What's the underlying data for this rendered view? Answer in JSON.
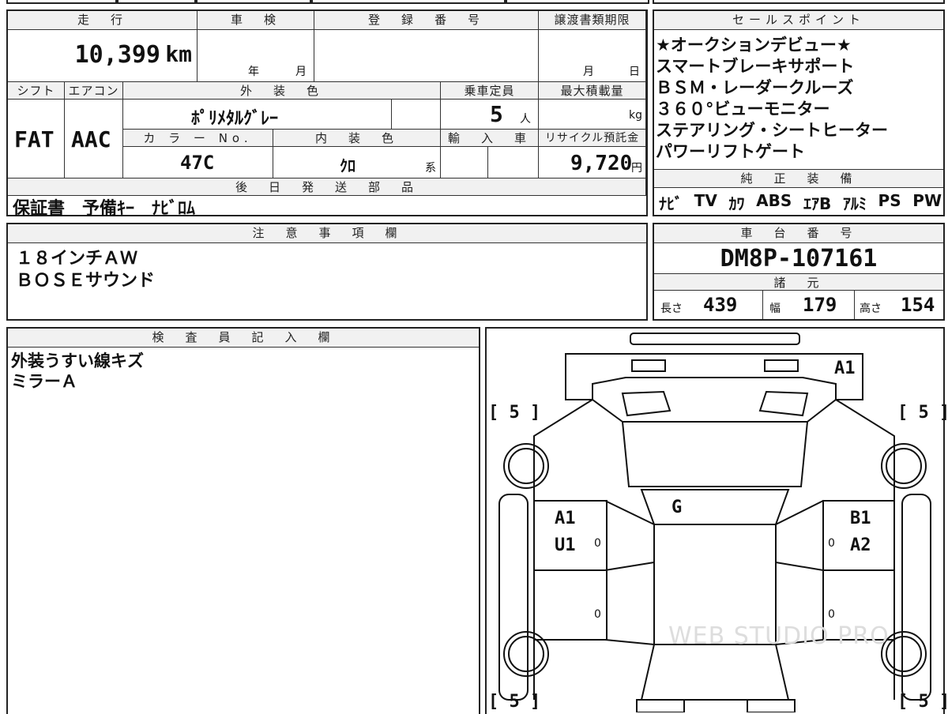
{
  "spec": {
    "mileage_header": "走　行",
    "shaken_header": "車　検",
    "registration_header": "登　録　番　号",
    "transfer_header": "譲渡書類期限",
    "mileage_value": "10,399",
    "mileage_unit": "km",
    "shaken_year": "年",
    "shaken_month": "月",
    "transfer_month": "月",
    "transfer_day": "日",
    "shift_header": "シフト",
    "aircon_header": "エアコン",
    "exterior_color_header": "外　装　色",
    "capacity_header": "乗車定員",
    "max_load_header": "最大積載量",
    "shift_value": "FAT",
    "aircon_value": "AAC",
    "exterior_color_value": "ﾎﾟﾘﾒﾀﾙｸﾞﾚｰ",
    "capacity_value": "5",
    "capacity_unit": "人",
    "max_load_unit": "kg",
    "color_no_header": "カ ラ ー No.",
    "interior_color_header": "内　装　色",
    "import_header": "輸　入　車",
    "recycle_header": "リサイクル預託金",
    "color_no_value": "47C",
    "interior_color_value": "ｸﾛ",
    "interior_suffix": "系",
    "recycle_value": "9,720",
    "recycle_unit": "円",
    "later_parts_header": "後　日　発　送　部　品",
    "later_parts_value": "保証書　予備ｷｰ　ﾅﾋﾞﾛﾑ"
  },
  "sales": {
    "header": "セールスポイント",
    "lines": [
      "★オークションデビュー★",
      "スマートブレーキサポート",
      "ＢＳＭ・レーダークルーズ",
      "３６０°ビューモニター",
      "ステアリング・シートヒーター",
      "パワーリフトゲート"
    ],
    "equipment_header": "純　正　装　備",
    "equipment": [
      "ﾅﾋﾞ",
      "TV",
      "ｶﾜ",
      "ABS",
      "ｴｱB",
      "ｱﾙﾐ",
      "PS",
      "PW"
    ]
  },
  "notes": {
    "header": "注　意　事　項　欄",
    "lines": [
      "１８インチＡＷ",
      "ＢＯＳＥサウンド"
    ]
  },
  "chassis": {
    "header": "車　台　番　号",
    "value": "DM8P-107161",
    "dims_header": "諸　元",
    "length_label": "長さ",
    "length_value": "439",
    "width_label": "幅",
    "width_value": "179",
    "height_label": "高さ",
    "height_value": "154"
  },
  "inspector": {
    "header": "検　査　員　記　入　欄",
    "lines": [
      "外装うすい線キズ",
      "ミラーＡ"
    ]
  },
  "diagram": {
    "marks": {
      "front": "A1",
      "tire_fl": "[ 5 ]",
      "tire_fr": "[ 5 ]",
      "tire_rl": "[ 5 ]",
      "tire_rr": "[ 5 ]",
      "roof": "G",
      "left_front_door_1": "A1",
      "left_front_door_2": "U1",
      "right_front_door_1": "B1",
      "right_front_door_2": "A2",
      "small_lf": "0",
      "small_rf": "0",
      "small_lr": "0",
      "small_rr": "0"
    },
    "watermark": "WEB STUDIO PRO"
  }
}
